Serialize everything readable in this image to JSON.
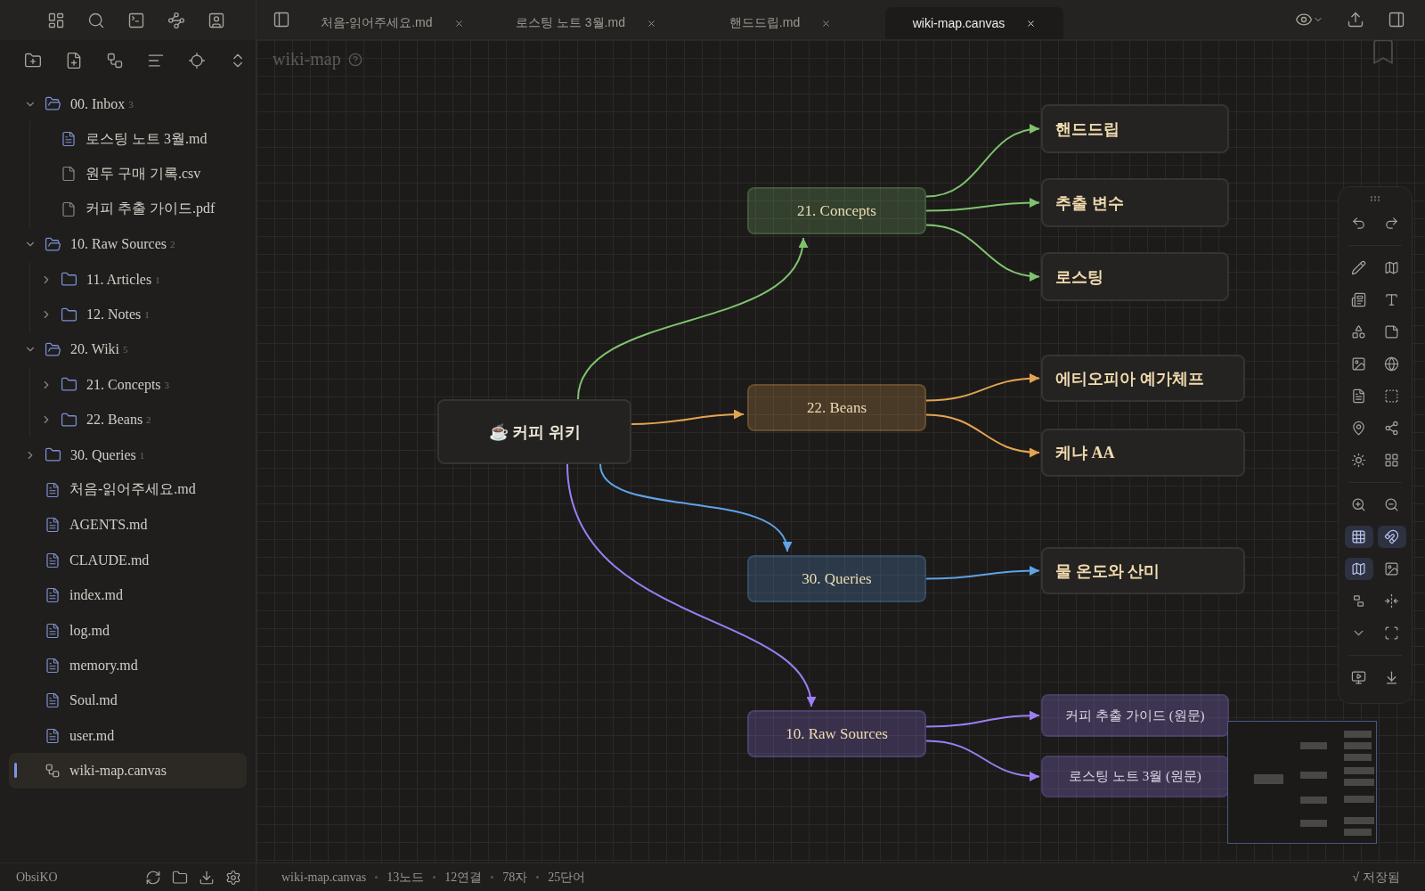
{
  "top_bar": {
    "tabs": [
      {
        "label": "처음-읽어주세요.md",
        "selected": false
      },
      {
        "label": "로스팅 노트 3월.md",
        "selected": false
      },
      {
        "label": "핸드드립.md",
        "selected": false
      },
      {
        "label": "wiki-map.canvas",
        "selected": true
      }
    ]
  },
  "sidebar": {
    "items": [
      {
        "label": "00. Inbox",
        "count": "3",
        "kind": "folder",
        "expanded": true,
        "selected": false,
        "children": [
          {
            "label": "로스팅 노트 3월.md",
            "kind": "note",
            "selected": false
          },
          {
            "label": "원두 구매 기록.csv",
            "kind": "file",
            "selected": false
          },
          {
            "label": "커피 추출 가이드.pdf",
            "kind": "file",
            "selected": false
          }
        ]
      },
      {
        "label": "10. Raw Sources",
        "count": "2",
        "kind": "folder",
        "expanded": true,
        "selected": false,
        "children": [
          {
            "label": "11. Articles",
            "count": "1",
            "kind": "folder",
            "expanded": false,
            "selected": false
          },
          {
            "label": "12. Notes",
            "count": "1",
            "kind": "folder",
            "expanded": false,
            "selected": false
          }
        ]
      },
      {
        "label": "20. Wiki",
        "count": "5",
        "kind": "folder",
        "expanded": true,
        "selected": false,
        "children": [
          {
            "label": "21. Concepts",
            "count": "3",
            "kind": "folder",
            "expanded": false,
            "selected": false
          },
          {
            "label": "22. Beans",
            "count": "2",
            "kind": "folder",
            "expanded": false,
            "selected": false
          }
        ]
      },
      {
        "label": "30. Queries",
        "count": "1",
        "kind": "folder",
        "expanded": false,
        "selected": false
      },
      {
        "label": "처음-읽어주세요.md",
        "kind": "note",
        "selected": false
      },
      {
        "label": "AGENTS.md",
        "kind": "note",
        "selected": false
      },
      {
        "label": "CLAUDE.md",
        "kind": "note",
        "selected": false
      },
      {
        "label": "index.md",
        "kind": "note",
        "selected": false
      },
      {
        "label": "log.md",
        "kind": "note",
        "selected": false
      },
      {
        "label": "memory.md",
        "kind": "note",
        "selected": false
      },
      {
        "label": "Soul.md",
        "kind": "note",
        "selected": false
      },
      {
        "label": "user.md",
        "kind": "note",
        "selected": false
      },
      {
        "label": "wiki-map.canvas",
        "kind": "canvas",
        "selected": true
      }
    ]
  },
  "canvas": {
    "title": "wiki-map",
    "hub": {
      "label": "☕ 커피 위키",
      "children": [
        {
          "label": "21. Concepts",
          "color": "#7fc36e",
          "children": [
            {
              "label": "핸드드립",
              "kind": "note"
            },
            {
              "label": "추출 변수",
              "kind": "note"
            },
            {
              "label": "로스팅",
              "kind": "note"
            }
          ]
        },
        {
          "label": "22. Beans",
          "color": "#e3a452",
          "children": [
            {
              "label": "에티오피아 예가체프",
              "kind": "note"
            },
            {
              "label": "케냐 AA",
              "kind": "note"
            }
          ]
        },
        {
          "label": "30. Queries",
          "color": "#5fa2e6",
          "children": [
            {
              "label": "물 온도와 산미",
              "kind": "note"
            }
          ]
        },
        {
          "label": "10. Raw Sources",
          "color": "#9d7ef2",
          "children": [
            {
              "label": "커피 추출 가이드 (원문)",
              "kind": "source"
            },
            {
              "label": "로스팅 노트 3월 (원문)",
              "kind": "source"
            }
          ]
        }
      ]
    }
  },
  "canvas_toolbar": {
    "grid_on": true,
    "magnet_on": true,
    "minimap_on": true
  },
  "vault": {
    "name": "ObsiKO"
  },
  "status_bar": {
    "file": "wiki-map.canvas",
    "stats": [
      "13노드",
      "12연결",
      "78자",
      "25단어"
    ],
    "saved": "√ 저장됨"
  }
}
